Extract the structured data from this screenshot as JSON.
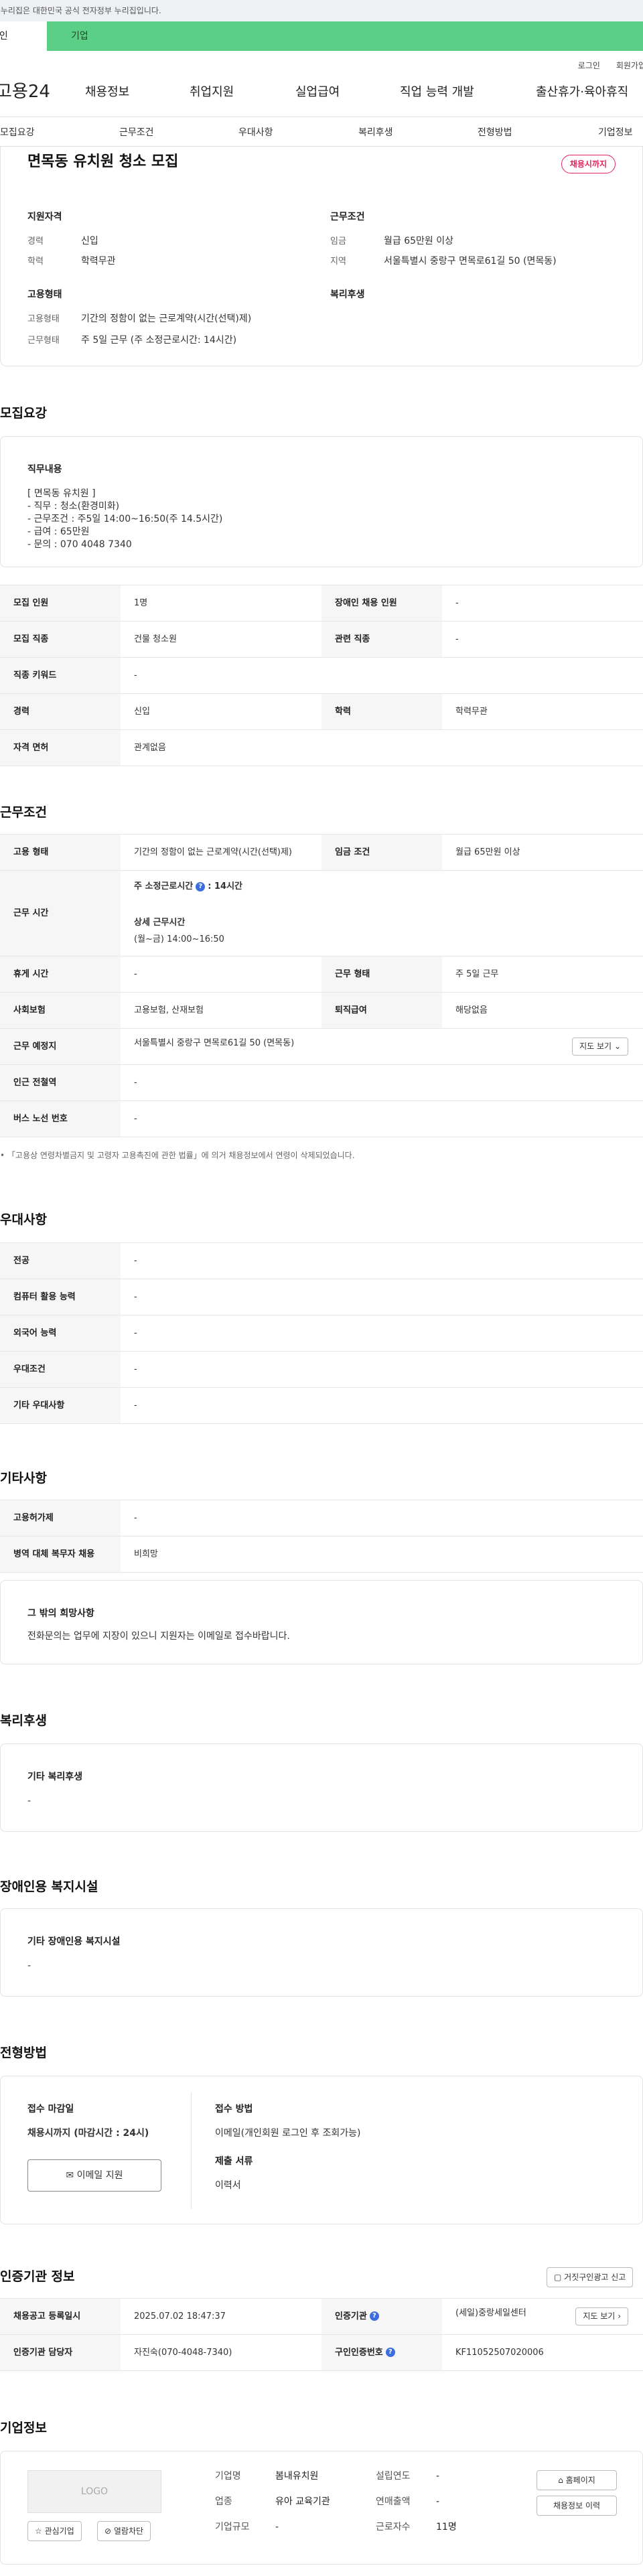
{
  "gov_bar": "이 누리집은 대한민국 공식 전자정부 누리집입니다.",
  "tabs": {
    "personal": "개인",
    "corporate": "기업"
  },
  "util": {
    "login": "로그인",
    "signup": "회원가입"
  },
  "logo": "고용24",
  "gnb": [
    "채용정보",
    "취업지원",
    "실업급여",
    "직업 능력 개발",
    "출산휴가·육아휴직"
  ],
  "subnav": [
    "모집요강",
    "근무조건",
    "우대사항",
    "복리후생",
    "전형방법",
    "기업정보"
  ],
  "job": {
    "title": "면목동 유치원 청소 모집",
    "badge": "채용시까지",
    "qual_heading": "지원자격",
    "qual": [
      {
        "k": "경력",
        "v": "신입"
      },
      {
        "k": "학력",
        "v": "학력무관"
      }
    ],
    "cond_heading": "근무조건",
    "cond": [
      {
        "k": "임금",
        "v": "월급 65만원 이상"
      },
      {
        "k": "지역",
        "v": "서울특별시 중랑구 면목로61길 50 (면목동)"
      }
    ],
    "emp_heading": "고용형태",
    "emp": [
      {
        "k": "고용형태",
        "v": "기간의 정함이 없는 근로계약(시간(선택)제)"
      },
      {
        "k": "근무형태",
        "v": "주 5일 근무 (주 소정근로시간: 14시간)"
      }
    ],
    "welfare_heading": "복리후생"
  },
  "recruit": {
    "heading": "모집요강",
    "duties_heading": "직무내용",
    "duties_text": "[ 면목동 유치원 ]\n- 직무 : 청소(환경미화)\n- 근무조건 : 주5일 14:00~16:50(주 14.5시간)\n- 급여 : 65만원\n- 문의 : 070 4048 7340",
    "rows": [
      {
        "k1": "모집 인원",
        "v1": "1명",
        "k2": "장애인 채용 인원",
        "v2": "-"
      },
      {
        "k1": "모집 직종",
        "v1": "건물 청소원",
        "k2": "관련 직종",
        "v2": "-"
      },
      {
        "k1": "직종 키워드",
        "v1": "-"
      },
      {
        "k1": "경력",
        "v1": "신입",
        "k2": "학력",
        "v2": "학력무관"
      },
      {
        "k1": "자격 면허",
        "v1": "관계없음"
      }
    ]
  },
  "conditions": {
    "heading": "근무조건",
    "emp_type_k": "고용 형태",
    "emp_type_v": "기간의 정함이 없는 근로계약(시간(선택)제)",
    "wage_k": "임금 조건",
    "wage_v": "월급 65만원 이상",
    "hours_k": "근무 시간",
    "hours_label": "주 소정근로시간",
    "hours_value": ": 14시간",
    "hours_detail_label": "상세 근무시간",
    "hours_detail": "(월~금) 14:00~16:50",
    "rest_k": "휴게 시간",
    "rest_v": "-",
    "form_k": "근무 형태",
    "form_v": "주 5일 근무",
    "ins_k": "사회보험",
    "ins_v": "고용보험, 산재보험",
    "sev_k": "퇴직급여",
    "sev_v": "해당없음",
    "place_k": "근무 예정지",
    "place_v": "서울특별시 중랑구 면목로61길 50 (면목동)",
    "map_btn": "지도 보기",
    "subway_k": "인근 전철역",
    "subway_v": "-",
    "bus_k": "버스 노선 번호",
    "bus_v": "-",
    "note": "「고용상 연령차별금지 및 고령자 고용촉진에 관한 법률」에 의거 채용정보에서 연령이 삭제되었습니다."
  },
  "preferences": {
    "heading": "우대사항",
    "rows": [
      {
        "k": "전공",
        "v": "-"
      },
      {
        "k": "컴퓨터 활용 능력",
        "v": "-"
      },
      {
        "k": "외국어 능력",
        "v": "-"
      },
      {
        "k": "우대조건",
        "v": "-"
      },
      {
        "k": "기타 우대사항",
        "v": "-"
      }
    ]
  },
  "etc": {
    "heading": "기타사항",
    "rows": [
      {
        "k": "고용허가제",
        "v": "-"
      },
      {
        "k": "병역 대체 복무자 채용",
        "v": "비희망"
      }
    ],
    "wish_heading": "그 밖의 희망사항",
    "wish_text": "전화문의는 업무에 지장이 있으니 지원자는 이메일로 접수바랍니다."
  },
  "benefits": {
    "heading": "복리후생",
    "sub": "기타 복리후생",
    "value": "-"
  },
  "disability": {
    "heading": "장애인용 복지시설",
    "sub": "기타 장애인용 복지시설",
    "value": "-"
  },
  "selection": {
    "heading": "전형방법",
    "deadline_label": "접수 마감일",
    "deadline_value": "채용시까지 (마감시간 : 24시)",
    "apply_btn": "이메일 지원",
    "method_label": "접수 방법",
    "method_value": "이메일(개인회원 로그인 후 조회가능)",
    "docs_label": "제출 서류",
    "docs_value": "이력서"
  },
  "agency": {
    "heading": "인증기관 정보",
    "report_btn": "거짓구인광고 신고",
    "reg_k": "채용공고 등록일시",
    "reg_v": "2025.07.02 18:47:37",
    "org_k": "인증기관",
    "org_v": "(세일)중랑세일센터",
    "map_btn": "지도 보기",
    "mgr_k": "인증기관 담당자",
    "mgr_v": "자진숙(070-4048-7340)",
    "num_k": "구인인증번호",
    "num_v": "KF11052507020006"
  },
  "company": {
    "heading": "기업정보",
    "logo": "LOGO",
    "fav_btn": "관심기업",
    "hide_btn": "열람차단",
    "fields": [
      {
        "k": "기업명",
        "v": "봄내유치원"
      },
      {
        "k": "업종",
        "v": "유아 교육기관"
      },
      {
        "k": "기업규모",
        "v": "-"
      }
    ],
    "fields2": [
      {
        "k": "설립연도",
        "v": "-"
      },
      {
        "k": "연매출액",
        "v": "-"
      },
      {
        "k": "근로자수",
        "v": "11명"
      }
    ],
    "home_btn": "홈페이지",
    "history_btn": "채용정보 이력"
  }
}
